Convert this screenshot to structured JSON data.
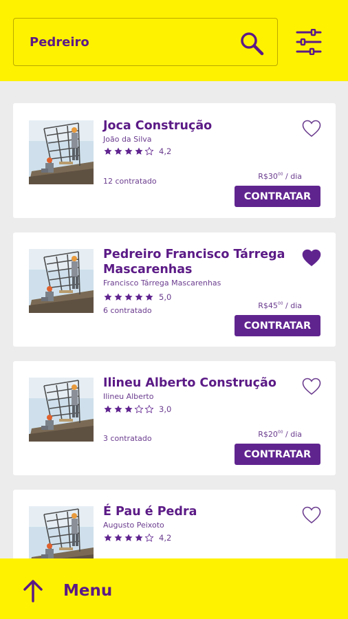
{
  "search": {
    "value": "Pedreiro"
  },
  "colors": {
    "brand_yellow": "#fff200",
    "brand_purple": "#60248f",
    "background": "#ececec"
  },
  "icons": {
    "search": "search-icon",
    "filter": "filter-sliders-icon",
    "favorite": "heart-icon",
    "menu": "arrow-up-icon"
  },
  "cards": [
    {
      "title_line1": "Joca Construção",
      "title_line2": "",
      "owner": "João da Silva",
      "stars": 4,
      "rating": "4,2",
      "hired": "12 contratado",
      "price_main": "R$30",
      "price_cents": "00",
      "price_unit": " / dia",
      "button": "CONTRATAR",
      "favorite": false
    },
    {
      "title_line1": "Pedreiro Francisco Tárrega",
      "title_line2": "Mascarenhas",
      "owner": "Francisco Tárrega Mascarenhas",
      "stars": 5,
      "rating": "5,0",
      "hired": "6 contratado",
      "price_main": "R$45",
      "price_cents": "00",
      "price_unit": " / dia",
      "button": "CONTRATAR",
      "favorite": true
    },
    {
      "title_line1": "Ilineu Alberto Construção",
      "title_line2": "",
      "owner": "Ilineu Alberto",
      "stars": 3,
      "rating": "3,0",
      "hired": "3 contratado",
      "price_main": "R$20",
      "price_cents": "00",
      "price_unit": " / dia",
      "button": "CONTRATAR",
      "favorite": false
    },
    {
      "title_line1": "É Pau é Pedra",
      "title_line2": "",
      "owner": "Augusto Peixoto",
      "stars": 4,
      "rating": "4,2",
      "favorite": false
    }
  ],
  "bottom": {
    "menu_label": "Menu"
  }
}
